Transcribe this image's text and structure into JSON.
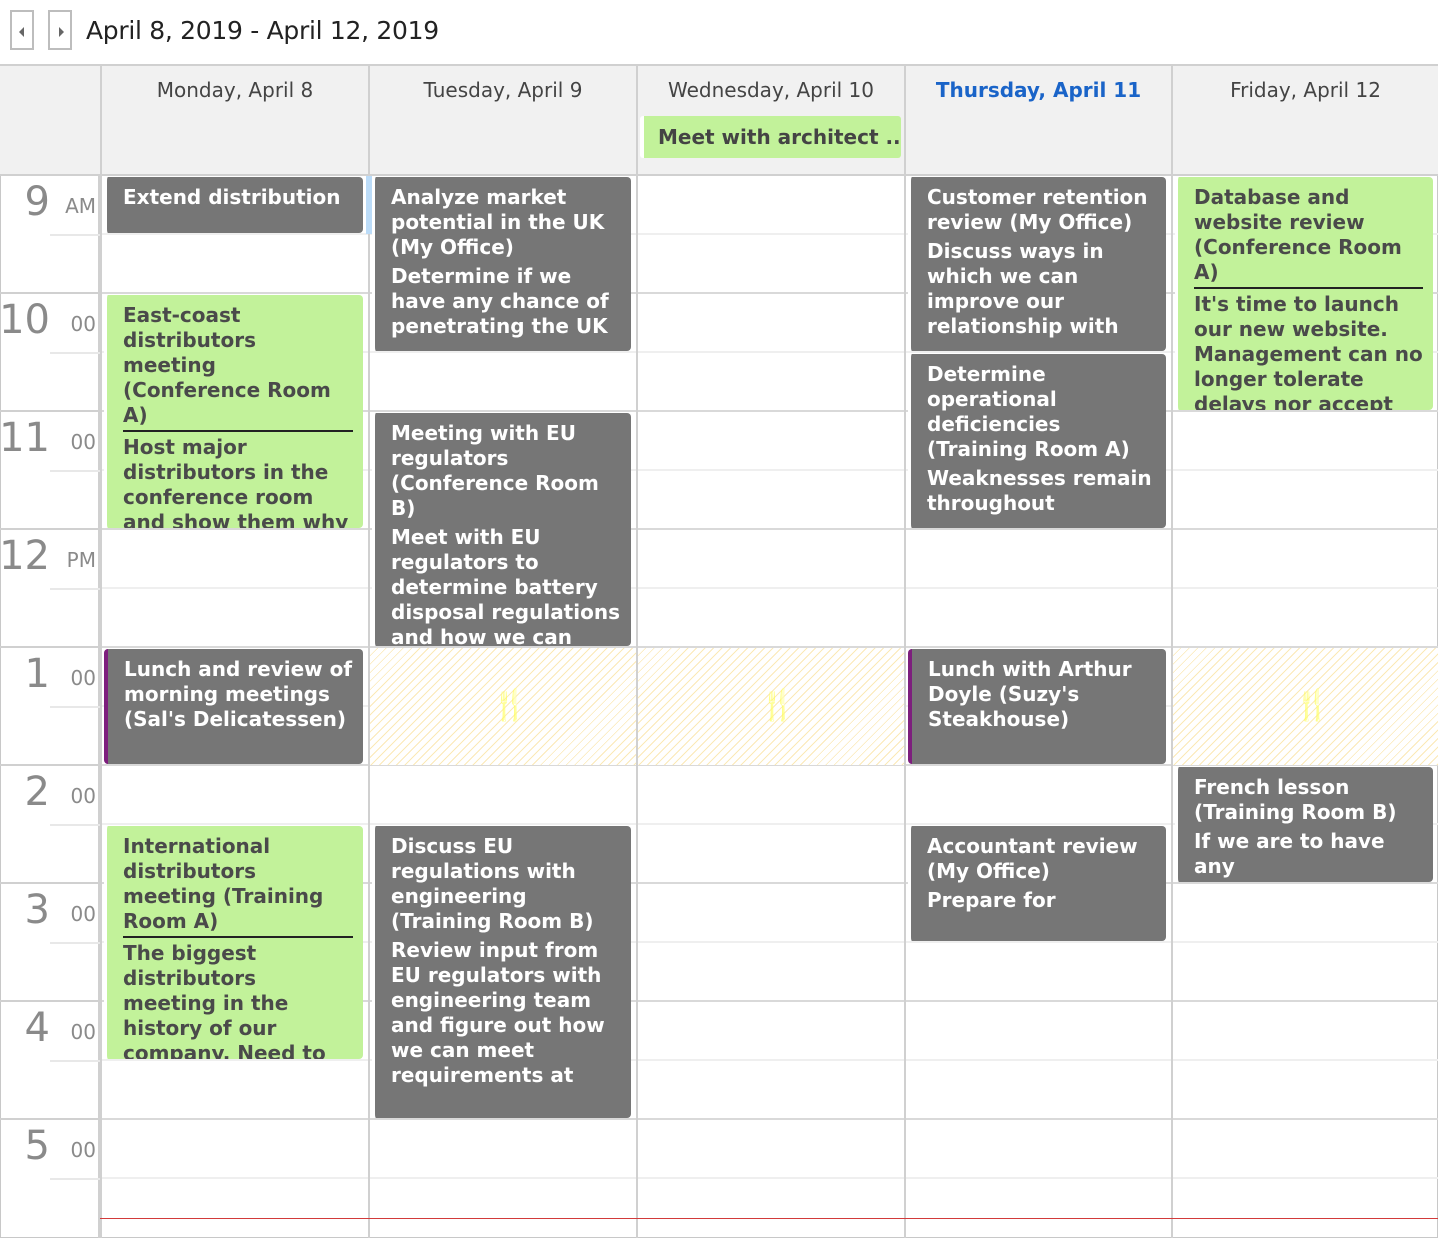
{
  "header": {
    "prev_icon": "chevron-left-icon",
    "next_icon": "chevron-right-icon",
    "date_range": "April 8, 2019 - April 12, 2019"
  },
  "days": [
    {
      "label": "Monday, April 8",
      "today": false
    },
    {
      "label": "Tuesday, April 9",
      "today": false
    },
    {
      "label": "Wednesday, April 10",
      "today": false,
      "all_day": "Meet with architect ..."
    },
    {
      "label": "Thursday, April 11",
      "today": true
    },
    {
      "label": "Friday, April 12",
      "today": false
    }
  ],
  "hours": [
    {
      "h": "9",
      "m": "AM"
    },
    {
      "h": "10",
      "m": "00"
    },
    {
      "h": "11",
      "m": "00"
    },
    {
      "h": "12",
      "m": "PM"
    },
    {
      "h": "1",
      "m": "00"
    },
    {
      "h": "2",
      "m": "00"
    },
    {
      "h": "3",
      "m": "00"
    },
    {
      "h": "4",
      "m": "00"
    },
    {
      "h": "5",
      "m": "00"
    }
  ],
  "lunch_icon": "fork-knife-icon",
  "appointments": [
    {
      "day": 0,
      "start": 9.0,
      "end": 9.5,
      "style": "gray",
      "title": "Extend distribution",
      "desc": ""
    },
    {
      "day": 0,
      "start": 10.0,
      "end": 12.0,
      "style": "green",
      "title": "East-coast distributors meeting (Conference Room A)",
      "desc": "Host major distributors in the conference room and show them why they need to start carrying"
    },
    {
      "day": 0,
      "start": 13.0,
      "end": 14.0,
      "style": "gray purple",
      "title": "Lunch and review of morning meetings (Sal's Delicatessen)",
      "desc": ""
    },
    {
      "day": 0,
      "start": 14.5,
      "end": 16.5,
      "style": "green",
      "title": "International distributors meeting (Training Room A)",
      "desc": "The biggest distributors meeting in the history of our company. Need to get our products into"
    },
    {
      "day": 1,
      "start": 9.0,
      "end": 10.5,
      "style": "gray",
      "title": "Analyze market potential in the UK (My Office)",
      "desc": "Determine if we have any chance of penetrating the UK"
    },
    {
      "day": 1,
      "start": 11.0,
      "end": 13.0,
      "style": "gray",
      "title": "Meeting with EU regulators (Conference Room B)",
      "desc": "Meet with EU regulators to determine battery disposal regulations and how we can"
    },
    {
      "day": 1,
      "start": 14.5,
      "end": 17.0,
      "style": "gray",
      "title": "Discuss EU regulations with engineering (Training Room B)",
      "desc": "Review input from EU regulators with engineering team and figure out how we can meet requirements at"
    },
    {
      "day": 3,
      "start": 9.0,
      "end": 10.5,
      "style": "gray",
      "title": "Customer retention review (My Office)",
      "desc": "Discuss ways in which we can improve our relationship with"
    },
    {
      "day": 3,
      "start": 10.5,
      "end": 12.0,
      "style": "gray",
      "title": "Determine operational deficiencies (Training Room A)",
      "desc": "Weaknesses remain throughout"
    },
    {
      "day": 3,
      "start": 13.0,
      "end": 14.0,
      "style": "gray purple",
      "title": "Lunch with Arthur Doyle (Suzy's Steakhouse)",
      "desc": ""
    },
    {
      "day": 3,
      "start": 14.5,
      "end": 15.5,
      "style": "gray",
      "title": "Accountant review (My Office)",
      "desc": "Prepare for"
    },
    {
      "day": 4,
      "start": 9.0,
      "end": 11.0,
      "style": "green",
      "title": "Database and website review (Conference Room A)",
      "desc": "It's time to launch our new website. Management can no longer tolerate delays nor accept excuses."
    },
    {
      "day": 4,
      "start": 14.0,
      "end": 15.0,
      "style": "gray",
      "title": "French lesson (Training Room B)",
      "desc": "If we are to have any"
    }
  ],
  "lunch_days": [
    1,
    2,
    4
  ]
}
